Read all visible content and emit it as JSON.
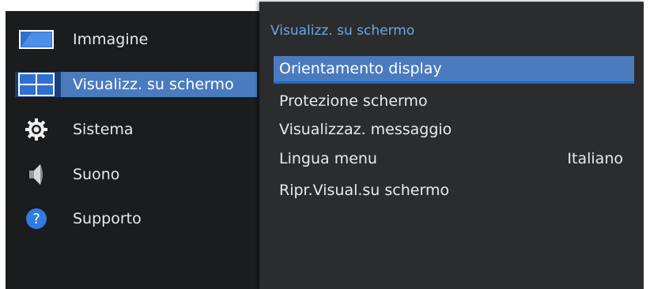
{
  "left_menu": {
    "items": [
      {
        "label": "Immagine",
        "icon": "picture-icon"
      },
      {
        "label": "Visualizz. su schermo",
        "icon": "onscreen-display-icon"
      },
      {
        "label": "Sistema",
        "icon": "gear-icon"
      },
      {
        "label": "Suono",
        "icon": "speaker-icon"
      },
      {
        "label": "Supporto",
        "icon": "question-icon"
      }
    ],
    "selected_index": 1
  },
  "submenu": {
    "title": "Visualizz. su schermo",
    "items": [
      {
        "label": "Orientamento display",
        "value": ""
      },
      {
        "label": "Protezione schermo",
        "value": ""
      },
      {
        "label": "Visualizzaz. messaggio",
        "value": ""
      },
      {
        "label": "Lingua menu",
        "value": "Italiano"
      },
      {
        "label": "Ripr.Visual.su schermo",
        "value": ""
      }
    ],
    "highlighted_index": 0
  },
  "colors": {
    "left_background": "#1b1c1e",
    "right_background": "#2b2c2e",
    "highlight": "#4a7bbf",
    "title_accent": "#6aa7e8"
  }
}
